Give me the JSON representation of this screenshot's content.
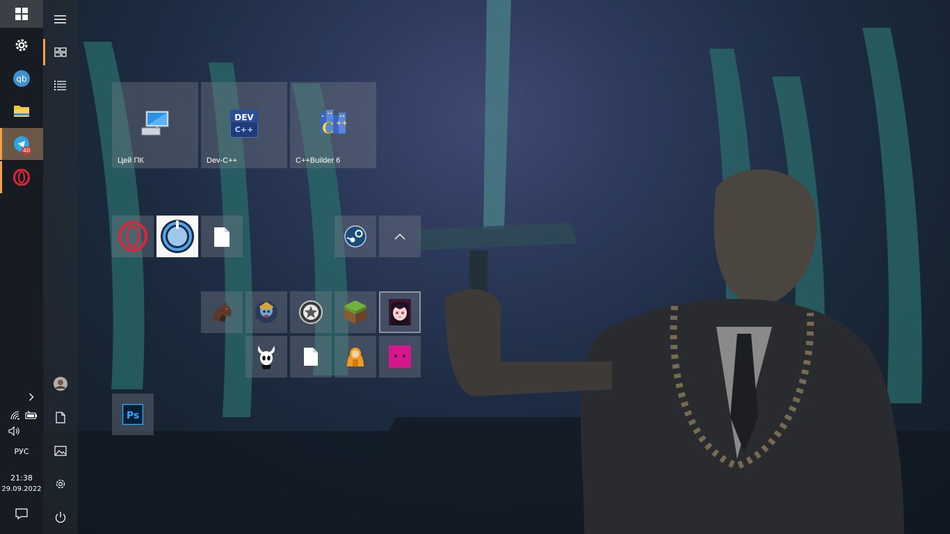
{
  "taskbar": {
    "apps": [
      {
        "name": "Settings",
        "icon": "gear-icon"
      },
      {
        "name": "qBittorrent",
        "icon": "qbittorrent-icon"
      },
      {
        "name": "File Explorer",
        "icon": "folder-icon"
      },
      {
        "name": "Telegram",
        "icon": "telegram-icon",
        "badge": "40"
      },
      {
        "name": "Opera",
        "icon": "opera-icon"
      }
    ],
    "tray": {
      "language": "РУС",
      "time": "21:38",
      "date": "29.09.2022"
    }
  },
  "start_menu": {
    "tiles": {
      "this_pc": "Цей ПК",
      "devcpp": "Dev-C++",
      "cppbuilder": "C++Builder 6"
    },
    "devcpp_logo_top": "DEV",
    "devcpp_logo_bottom": "C++",
    "cppbuilder_logo": "C++",
    "photoshop_logo": "Ps"
  },
  "colors": {
    "accent": "#f5a340",
    "tile_bg": "#6e737c",
    "opera_red": "#e0243b",
    "telegram_blue": "#2ca5e0",
    "steam_blue": "#1b4d7a"
  }
}
